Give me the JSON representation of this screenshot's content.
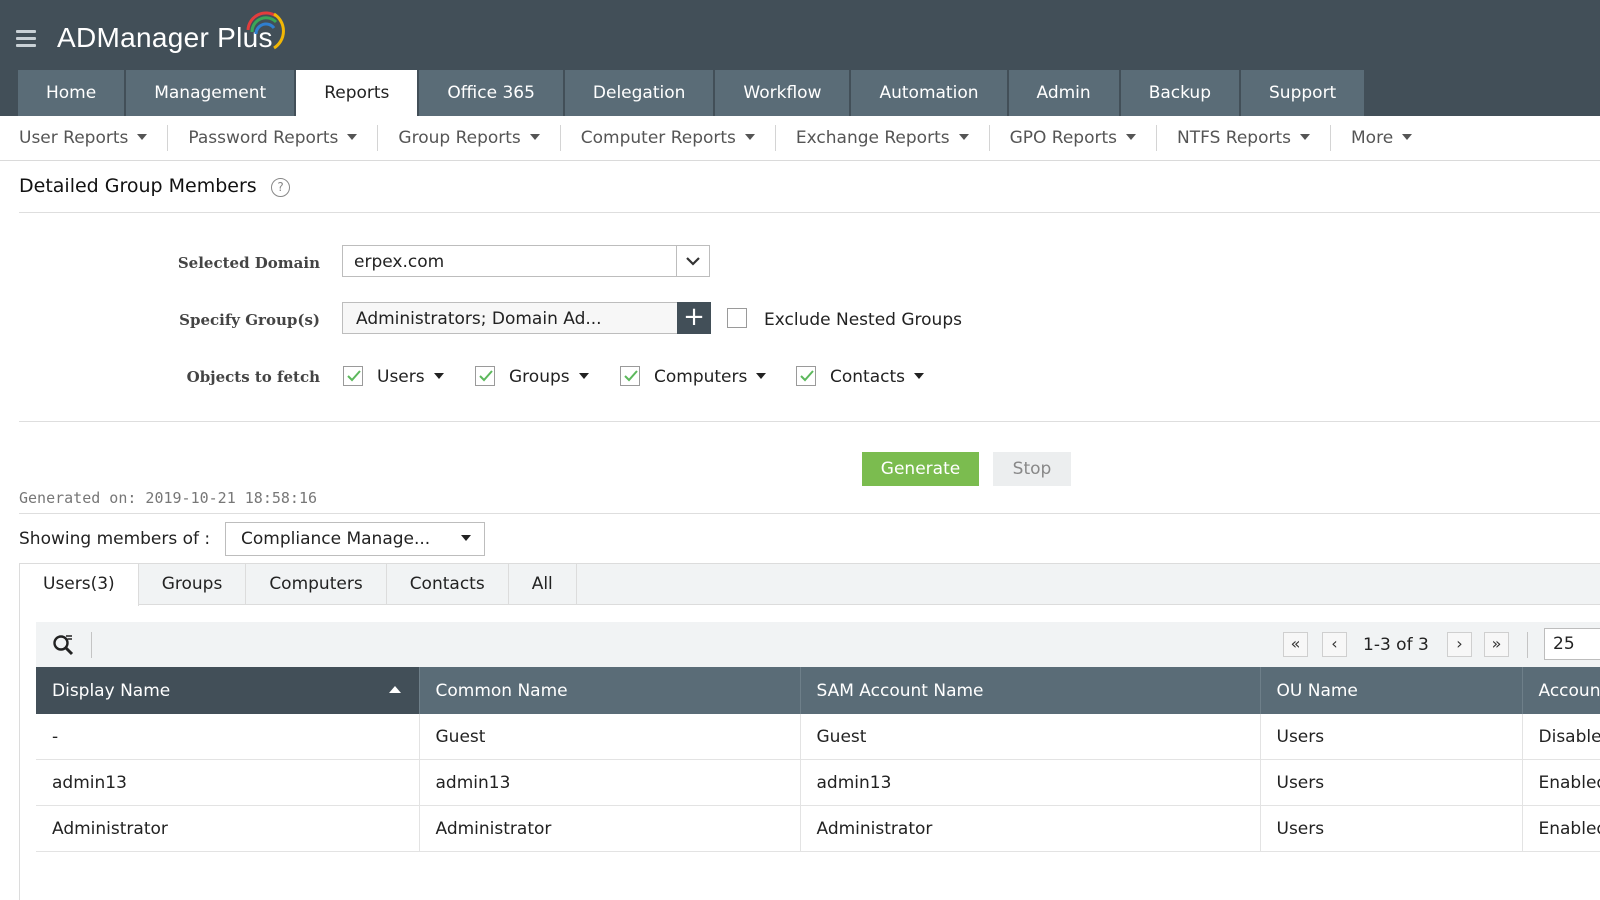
{
  "app": {
    "title": "ADManager Plus"
  },
  "nav": [
    "Home",
    "Management",
    "Reports",
    "Office 365",
    "Delegation",
    "Workflow",
    "Automation",
    "Admin",
    "Backup",
    "Support"
  ],
  "subnav": [
    "User Reports",
    "Password Reports",
    "Group Reports",
    "Computer Reports",
    "Exchange Reports",
    "GPO Reports",
    "NTFS Reports",
    "More"
  ],
  "page": {
    "title": "Detailed Group Members",
    "help": "?"
  },
  "form": {
    "domain_label": "Selected Domain",
    "domain_value": "erpex.com",
    "group_label": "Specify Group(s)",
    "group_value": "Administrators; Domain Ad...",
    "add_symbol": "+",
    "exclude_label": "Exclude Nested Groups",
    "objects_label": "Objects to fetch",
    "objects": [
      {
        "label": "Users",
        "checked": true
      },
      {
        "label": "Groups",
        "checked": true
      },
      {
        "label": "Computers",
        "checked": true
      },
      {
        "label": "Contacts",
        "checked": true
      }
    ]
  },
  "actions": {
    "generate": "Generate",
    "stop": "Stop"
  },
  "result": {
    "generated_on": "Generated on: 2019-10-21 18:58:16",
    "showing_label": "Showing members of :",
    "showing_value": "Compliance Manage...",
    "tabs": [
      "Users(3)",
      "Groups",
      "Computers",
      "Contacts",
      "All"
    ],
    "pager": {
      "range": "1-3 of 3",
      "per_page": "25"
    },
    "columns": [
      "Display Name",
      "Common Name",
      "SAM Account Name",
      "OU Name",
      "Account Status"
    ],
    "rows": [
      [
        "-",
        "Guest",
        "Guest",
        "Users",
        "Disabled"
      ],
      [
        "admin13",
        "admin13",
        "admin13",
        "Users",
        "Enabled"
      ],
      [
        "Administrator",
        "Administrator",
        "Administrator",
        "Users",
        "Enabled"
      ]
    ]
  },
  "colors": {
    "header": "#424f58",
    "tab": "#5a6c77",
    "generate": "#7bbc4f"
  }
}
